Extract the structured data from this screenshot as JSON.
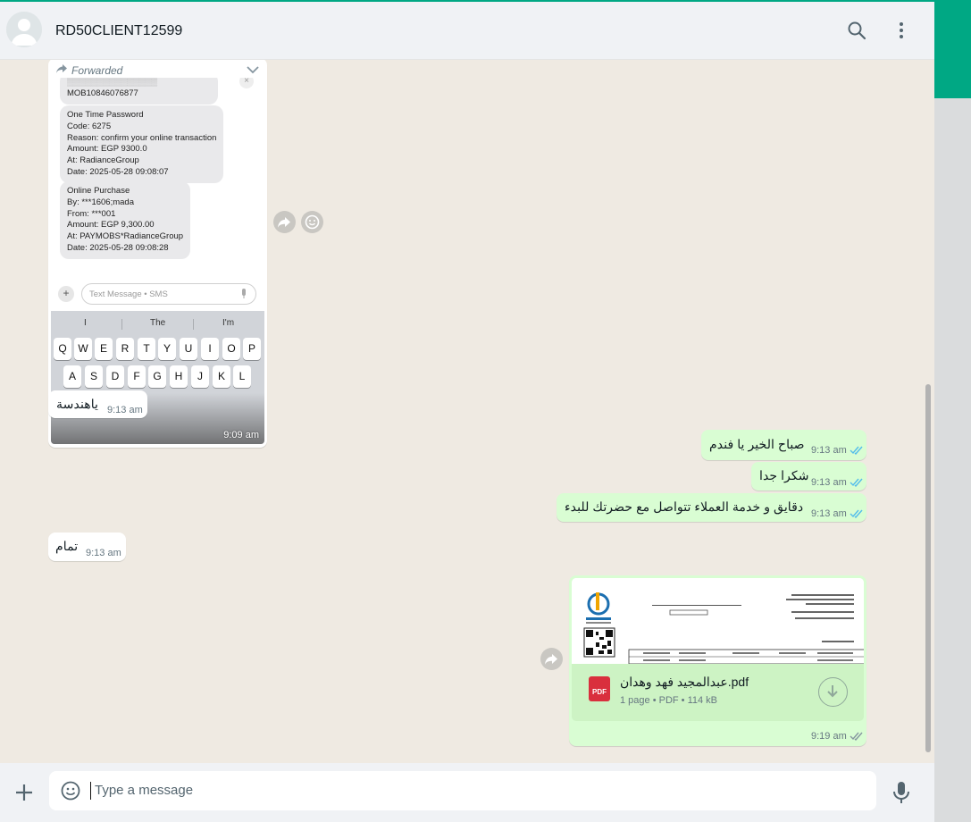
{
  "header": {
    "contact_name": "RD50CLIENT12599"
  },
  "forwarded_message": {
    "label": "Forwarded",
    "time": "9:09 am",
    "screenshot": {
      "partial_top_text": "MOB10846076877",
      "otp_message": [
        "One Time Password",
        "Code: 6275",
        "Reason: confirm your online transaction",
        "Amount: EGP 9300.0",
        "At: RadianceGroup",
        "Date: 2025-05-28 09:08:07"
      ],
      "purchase_message": [
        "Online Purchase",
        "By: ***1606;mada",
        "From: ***001",
        "Amount: EGP 9,300.00",
        "At: PAYMOBS*RadianceGroup",
        "Date: 2025-05-28 09:08:28"
      ],
      "sms_placeholder": "Text Message • SMS",
      "suggestions": [
        "I",
        "The",
        "I'm"
      ],
      "keys_row1": [
        "Q",
        "W",
        "E",
        "R",
        "T",
        "Y",
        "U",
        "I",
        "O",
        "P"
      ],
      "keys_row2": [
        "A",
        "S",
        "D",
        "F",
        "G",
        "H",
        "J",
        "K",
        "L"
      ]
    }
  },
  "messages": [
    {
      "dir": "in",
      "text": "ياهندسة",
      "time": "9:13 am"
    },
    {
      "dir": "out",
      "text": "صباح الخير يا فندم",
      "time": "9:13 am"
    },
    {
      "dir": "out",
      "text": "شكرا جدا",
      "time": "9:13 am"
    },
    {
      "dir": "out",
      "text": "دقايق و خدمة العملاء تتواصل مع حضرتك للبدء",
      "time": "9:13 am"
    },
    {
      "dir": "in",
      "text": "تمام",
      "time": "9:13 am"
    }
  ],
  "document": {
    "filename": "عبدالمجيد فهد وهدان.pdf",
    "details": "1 page • PDF • 114 kB",
    "badge": "PDF",
    "time": "9:19 am"
  },
  "composer": {
    "placeholder": "Type a message"
  },
  "colors": {
    "accent": "#00a884",
    "outgoing": "#d9fdd3",
    "incoming": "#ffffff",
    "read_ticks": "#53bdeb"
  }
}
